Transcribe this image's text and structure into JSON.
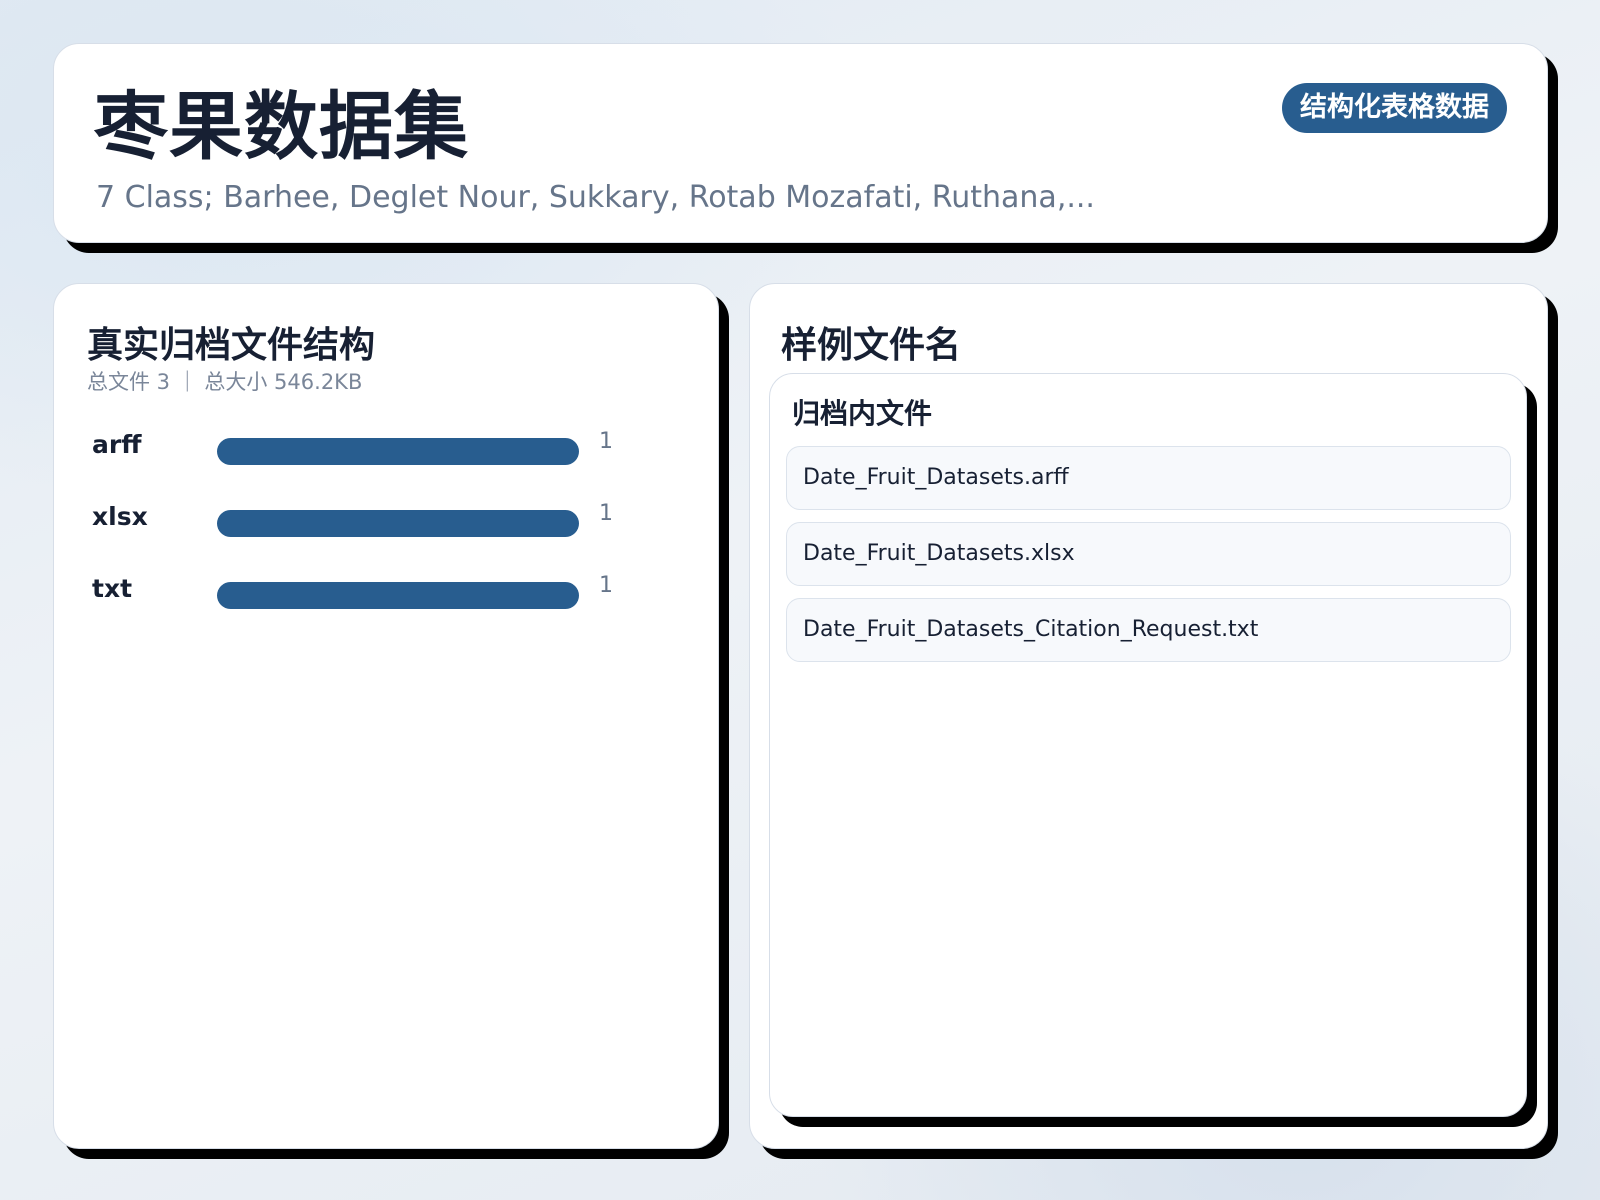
{
  "header": {
    "title": "枣果数据集",
    "subtitle": "7 Class; Barhee, Deglet Nour, Sukkary, Rotab Mozafati, Ruthana,...",
    "badge": "结构化表格数据"
  },
  "left_panel": {
    "title": "真实归档文件结构",
    "meta": "总文件 3 ｜ 总大小 546.2KB"
  },
  "right_panel": {
    "title": "样例文件名",
    "inner_title": "归档内文件",
    "files": [
      "Date_Fruit_Datasets.arff",
      "Date_Fruit_Datasets.xlsx",
      "Date_Fruit_Datasets_Citation_Request.txt"
    ]
  },
  "colors": {
    "accent": "#285d8f",
    "text": "#172033",
    "muted": "#66758a"
  },
  "chart_data": {
    "type": "bar",
    "orientation": "horizontal",
    "categories": [
      "arff",
      "xlsx",
      "txt"
    ],
    "values": [
      1,
      1,
      1
    ],
    "xlim": [
      0,
      1
    ]
  }
}
